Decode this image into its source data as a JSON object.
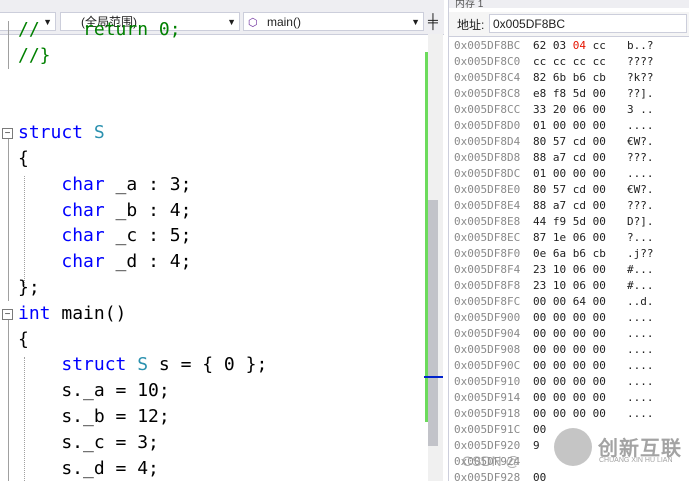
{
  "nav": {
    "scope_label": "(全局范围)",
    "function_label": "main()",
    "left_combo_label": "",
    "split_icon": "split-window-icon",
    "function_icon": "cube-icon"
  },
  "editor": {
    "lines": [
      {
        "id": "l0",
        "frag": [
          [
            "cmt",
            "//    return 0;"
          ]
        ]
      },
      {
        "id": "l1",
        "frag": [
          [
            "cmt",
            "//}"
          ]
        ]
      },
      {
        "id": "l2",
        "frag": []
      },
      {
        "id": "l3",
        "frag": []
      },
      {
        "id": "l4",
        "frag": [
          [
            "kw",
            "struct"
          ],
          [
            "ident",
            " "
          ],
          [
            "ty",
            "S"
          ]
        ]
      },
      {
        "id": "l5",
        "frag": [
          [
            "ident",
            "{"
          ]
        ]
      },
      {
        "id": "l6",
        "frag": [
          [
            "ident",
            "    "
          ],
          [
            "kw",
            "char"
          ],
          [
            "ident",
            " _a : 3;"
          ]
        ]
      },
      {
        "id": "l7",
        "frag": [
          [
            "ident",
            "    "
          ],
          [
            "kw",
            "char"
          ],
          [
            "ident",
            " _b : 4;"
          ]
        ]
      },
      {
        "id": "l8",
        "frag": [
          [
            "ident",
            "    "
          ],
          [
            "kw",
            "char"
          ],
          [
            "ident",
            " _c : 5;"
          ]
        ]
      },
      {
        "id": "l9",
        "frag": [
          [
            "ident",
            "    "
          ],
          [
            "kw",
            "char"
          ],
          [
            "ident",
            " _d : 4;"
          ]
        ]
      },
      {
        "id": "l10",
        "frag": [
          [
            "ident",
            "};"
          ]
        ]
      },
      {
        "id": "l11",
        "frag": [
          [
            "kw",
            "int"
          ],
          [
            "ident",
            " main()"
          ]
        ]
      },
      {
        "id": "l12",
        "frag": [
          [
            "ident",
            "{"
          ]
        ]
      },
      {
        "id": "l13",
        "frag": [
          [
            "ident",
            "    "
          ],
          [
            "kw",
            "struct"
          ],
          [
            "ident",
            " "
          ],
          [
            "ty",
            "S"
          ],
          [
            "ident",
            " s = { 0 };"
          ]
        ]
      },
      {
        "id": "l14",
        "frag": [
          [
            "ident",
            "    s._a = 10;"
          ]
        ]
      },
      {
        "id": "l15",
        "frag": [
          [
            "ident",
            "    s._b = 12;"
          ]
        ]
      },
      {
        "id": "l16",
        "frag": [
          [
            "ident",
            "    s._c = 3;"
          ]
        ]
      },
      {
        "id": "l17",
        "frag": [
          [
            "ident",
            "    s._d = 4;"
          ]
        ]
      }
    ]
  },
  "memory": {
    "title": "内存 1",
    "address_label": "地址:",
    "address_value": "0x005DF8BC",
    "rows": [
      {
        "addr": "0x005DF8BC",
        "bytes": [
          "62",
          "03",
          "04",
          "cc"
        ],
        "changed": [
          2
        ],
        "ascii": "b..?"
      },
      {
        "addr": "0x005DF8C0",
        "bytes": [
          "cc",
          "cc",
          "cc",
          "cc"
        ],
        "changed": [],
        "ascii": "????"
      },
      {
        "addr": "0x005DF8C4",
        "bytes": [
          "82",
          "6b",
          "b6",
          "cb"
        ],
        "changed": [],
        "ascii": "?k??"
      },
      {
        "addr": "0x005DF8C8",
        "bytes": [
          "e8",
          "f8",
          "5d",
          "00"
        ],
        "changed": [],
        "ascii": "??]."
      },
      {
        "addr": "0x005DF8CC",
        "bytes": [
          "33",
          "20",
          "06",
          "00"
        ],
        "changed": [],
        "ascii": "3 .."
      },
      {
        "addr": "0x005DF8D0",
        "bytes": [
          "01",
          "00",
          "00",
          "00"
        ],
        "changed": [],
        "ascii": "...."
      },
      {
        "addr": "0x005DF8D4",
        "bytes": [
          "80",
          "57",
          "cd",
          "00"
        ],
        "changed": [],
        "ascii": "€W?."
      },
      {
        "addr": "0x005DF8D8",
        "bytes": [
          "88",
          "a7",
          "cd",
          "00"
        ],
        "changed": [],
        "ascii": "???."
      },
      {
        "addr": "0x005DF8DC",
        "bytes": [
          "01",
          "00",
          "00",
          "00"
        ],
        "changed": [],
        "ascii": "...."
      },
      {
        "addr": "0x005DF8E0",
        "bytes": [
          "80",
          "57",
          "cd",
          "00"
        ],
        "changed": [],
        "ascii": "€W?."
      },
      {
        "addr": "0x005DF8E4",
        "bytes": [
          "88",
          "a7",
          "cd",
          "00"
        ],
        "changed": [],
        "ascii": "???."
      },
      {
        "addr": "0x005DF8E8",
        "bytes": [
          "44",
          "f9",
          "5d",
          "00"
        ],
        "changed": [],
        "ascii": "D?]."
      },
      {
        "addr": "0x005DF8EC",
        "bytes": [
          "87",
          "1e",
          "06",
          "00"
        ],
        "changed": [],
        "ascii": "?..."
      },
      {
        "addr": "0x005DF8F0",
        "bytes": [
          "0e",
          "6a",
          "b6",
          "cb"
        ],
        "changed": [],
        "ascii": ".j??"
      },
      {
        "addr": "0x005DF8F4",
        "bytes": [
          "23",
          "10",
          "06",
          "00"
        ],
        "changed": [],
        "ascii": "#..."
      },
      {
        "addr": "0x005DF8F8",
        "bytes": [
          "23",
          "10",
          "06",
          "00"
        ],
        "changed": [],
        "ascii": "#..."
      },
      {
        "addr": "0x005DF8FC",
        "bytes": [
          "00",
          "00",
          "64",
          "00"
        ],
        "changed": [],
        "ascii": "..d."
      },
      {
        "addr": "0x005DF900",
        "bytes": [
          "00",
          "00",
          "00",
          "00"
        ],
        "changed": [],
        "ascii": "...."
      },
      {
        "addr": "0x005DF904",
        "bytes": [
          "00",
          "00",
          "00",
          "00"
        ],
        "changed": [],
        "ascii": "...."
      },
      {
        "addr": "0x005DF908",
        "bytes": [
          "00",
          "00",
          "00",
          "00"
        ],
        "changed": [],
        "ascii": "...."
      },
      {
        "addr": "0x005DF90C",
        "bytes": [
          "00",
          "00",
          "00",
          "00"
        ],
        "changed": [],
        "ascii": "...."
      },
      {
        "addr": "0x005DF910",
        "bytes": [
          "00",
          "00",
          "00",
          "00"
        ],
        "changed": [],
        "ascii": "...."
      },
      {
        "addr": "0x005DF914",
        "bytes": [
          "00",
          "00",
          "00",
          "00"
        ],
        "changed": [],
        "ascii": "...."
      },
      {
        "addr": "0x005DF918",
        "bytes": [
          "00",
          "00",
          "00",
          "00"
        ],
        "changed": [],
        "ascii": "...."
      },
      {
        "addr": "0x005DF91C",
        "bytes": [
          "00",
          "",
          "",
          ""
        ],
        "changed": [],
        "ascii": ""
      },
      {
        "addr": "0x005DF920",
        "bytes": [
          "9",
          "",
          "",
          ""
        ],
        "changed": [],
        "ascii": ""
      },
      {
        "addr": "0x005DF924",
        "bytes": [
          "",
          "",
          "",
          ""
        ],
        "changed": [],
        "ascii": ""
      },
      {
        "addr": "0x005DF928",
        "bytes": [
          "00",
          "",
          "",
          ""
        ],
        "changed": [],
        "ascii": ""
      }
    ]
  },
  "watermark": {
    "csdn": "CSDN @",
    "brand": "创新互联",
    "brand_sub": "CHUANG XIN HU LIAN"
  },
  "colors": {
    "keyword": "#0000ff",
    "type": "#2b91af",
    "comment": "#008000",
    "changed_byte": "#e51400",
    "change_bar": "#6cdb5c"
  }
}
